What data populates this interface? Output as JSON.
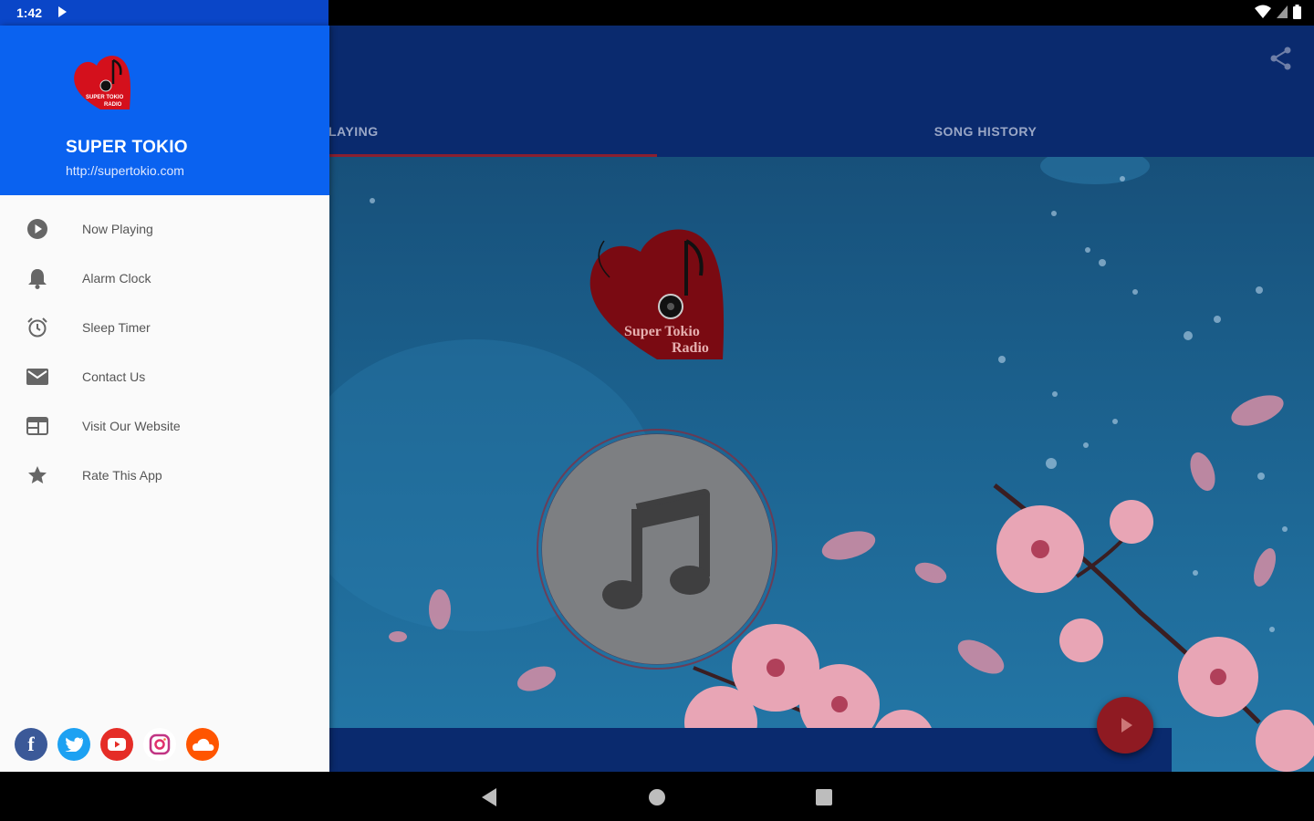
{
  "status_bar": {
    "time": "1:42",
    "icons": [
      "play-icon",
      "wifi-icon",
      "signal-icon",
      "battery-icon"
    ]
  },
  "drawer": {
    "station_name": "SUPER TOKIO",
    "station_url": "http://supertokio.com",
    "logo_text": "Super Tokio Radio",
    "menu": [
      {
        "label": "Now Playing",
        "icon": "play-circle-icon"
      },
      {
        "label": "Alarm Clock",
        "icon": "bell-icon"
      },
      {
        "label": "Sleep Timer",
        "icon": "alarm-clock-icon"
      },
      {
        "label": "Contact Us",
        "icon": "mail-icon"
      },
      {
        "label": "Visit Our Website",
        "icon": "web-icon"
      },
      {
        "label": "Rate This App",
        "icon": "star-icon"
      }
    ],
    "socials": [
      {
        "name": "facebook-icon",
        "glyph": "f",
        "color": "#3b5998"
      },
      {
        "name": "twitter-icon",
        "glyph": "t",
        "color": "#1da1f2"
      },
      {
        "name": "youtube-icon",
        "glyph": "▶",
        "color": "#e52d27"
      },
      {
        "name": "instagram-icon",
        "glyph": "◎",
        "color": "#c13584"
      },
      {
        "name": "soundcloud-icon",
        "glyph": "☁",
        "color": "#ff5500"
      }
    ]
  },
  "app": {
    "tabs": [
      "NOW PLAYING",
      "SONG HISTORY"
    ],
    "visible_tab_1": "LAYING",
    "logo_text_line1": "Super Tokio",
    "logo_text_line2": "Radio"
  },
  "colors": {
    "drawer_header": "#0a62f0",
    "app_bar": "#0a2a6e",
    "accent_red": "#8f1a22"
  }
}
